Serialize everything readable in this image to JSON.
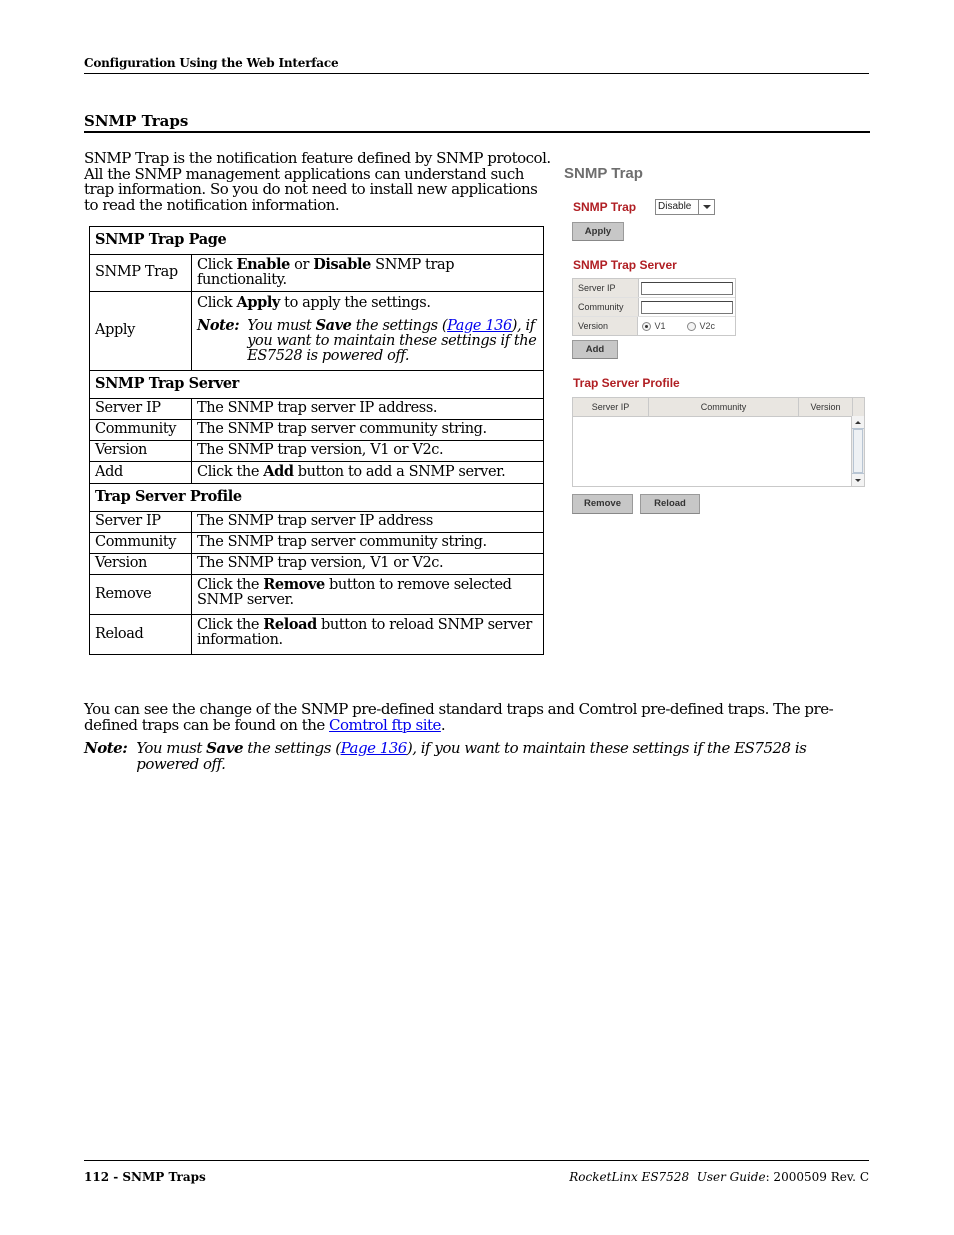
{
  "header": {
    "running_head": "Configuration Using the Web Interface"
  },
  "section": {
    "title": "SNMP Traps",
    "intro": "SNMP Trap is the notification feature defined by SNMP protocol. All the SNMP management applications can understand such trap information. So you do not need to install new applications to read the notification information."
  },
  "table": {
    "sections": [
      {
        "title": "SNMP Trap Page",
        "rows": [
          {
            "label": "SNMP Trap",
            "pre": "Click ",
            "b1": "Enable",
            "mid": " or ",
            "b2": "Disable",
            "post": " SNMP trap functionality."
          },
          {
            "label": "Apply",
            "pre": "Click ",
            "b1": "Apply",
            "post": " to apply the settings.",
            "note": {
              "label": "Note:",
              "pre": "You must ",
              "bold": "Save",
              "mid": " the settings (",
              "link": "Page 136",
              "post": "), if you want to maintain these settings if the ES7528 is powered off."
            }
          }
        ]
      },
      {
        "title": "SNMP Trap Server",
        "rows": [
          {
            "label": "Server IP",
            "text": "The SNMP trap server IP address."
          },
          {
            "label": "Community",
            "text": "The SNMP trap server community string."
          },
          {
            "label": "Version",
            "text": "The SNMP trap version, V1 or V2c."
          },
          {
            "label": "Add",
            "pre": "Click the ",
            "b1": "Add",
            "post": " button to add a SNMP server."
          }
        ]
      },
      {
        "title": "Trap Server Profile",
        "rows": [
          {
            "label": "Server IP",
            "text": "The SNMP trap server IP address"
          },
          {
            "label": "Community",
            "text": "The SNMP trap server community string."
          },
          {
            "label": "Version",
            "text": "The SNMP trap version, V1 or V2c."
          },
          {
            "label": "Remove",
            "pre": "Click the ",
            "b1": "Remove",
            "post": " button to remove selected SNMP server."
          },
          {
            "label": "Reload",
            "pre": "Click the ",
            "b1": "Reload",
            "post": " button to reload SNMP server information."
          }
        ]
      }
    ]
  },
  "body": {
    "para_pre": "You can see the change of the SNMP pre-defined standard traps and Comtrol pre-defined traps. The pre-defined traps can be found on the ",
    "para_link": "Comtrol ftp site",
    "para_post": ".",
    "note_label": "Note:",
    "note_pre": "You must ",
    "note_bold": "Save",
    "note_mid": " the settings (",
    "note_link": "Page 136",
    "note_post": "), if you want to maintain these settings if the ES7528 is powered off."
  },
  "ui": {
    "title": "SNMP Trap",
    "trap_label": "SNMP Trap",
    "trap_select_value": "Disable",
    "apply_label": "Apply",
    "server_heading": "SNMP Trap Server",
    "server_ip_label": "Server IP",
    "server_ip_value": "",
    "community_label": "Community",
    "community_value": "",
    "version_label": "Version",
    "version_options": [
      "V1",
      "V2c"
    ],
    "version_selected": "V1",
    "add_label": "Add",
    "profile_heading": "Trap Server Profile",
    "profile_columns": [
      "Server IP",
      "Community",
      "Version"
    ],
    "profile_rows": [],
    "remove_label": "Remove",
    "reload_label": "Reload",
    "accent_color": "#b01e23"
  },
  "footer": {
    "left": "112 - SNMP Traps",
    "right_italic": "RocketLinx ES7528  User Guide",
    "right_plain": ": 2000509 Rev. C"
  }
}
